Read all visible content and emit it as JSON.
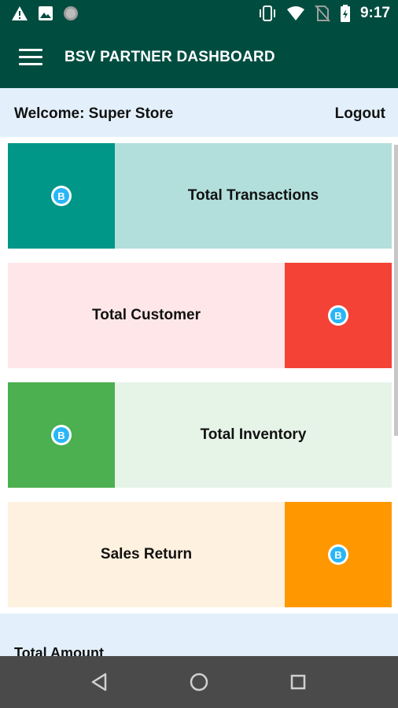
{
  "status_bar": {
    "time": "9:17",
    "left_icons": [
      "warning-icon",
      "image-icon",
      "circle-icon"
    ],
    "right_icons": [
      "vibrate-icon",
      "wifi-icon",
      "no-sim-icon",
      "battery-icon"
    ]
  },
  "app_bar": {
    "title": "BSV PARTNER DASHBOARD",
    "menu_icon": "hamburger-menu-icon"
  },
  "welcome_bar": {
    "welcome": "Welcome: Super Store",
    "logout": "Logout"
  },
  "cards": [
    {
      "label": "Total Transactions",
      "icon_side": "left",
      "icon_color": "#009688",
      "bg_color": "#b2dfdb"
    },
    {
      "label": "Total Customer",
      "icon_side": "right",
      "icon_color": "#f44336",
      "bg_color": "#ffe7e9"
    },
    {
      "label": "Total Inventory",
      "icon_side": "left",
      "icon_color": "#4caf50",
      "bg_color": "#e6f4e8"
    },
    {
      "label": "Sales Return",
      "icon_side": "right",
      "icon_color": "#ff9800",
      "bg_color": "#fff1df"
    }
  ],
  "total_amount_label": "Total Amount",
  "nav_bar": {
    "buttons": [
      "back-icon",
      "home-icon",
      "recents-icon"
    ]
  },
  "colors": {
    "primary": "#004d40",
    "welcome_bg": "#e3f0fb",
    "nav_bg": "#4a4a4a"
  }
}
